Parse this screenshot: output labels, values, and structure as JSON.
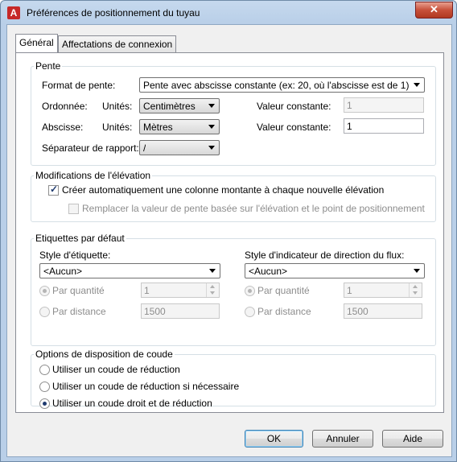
{
  "window": {
    "title": "Préférences de positionnement du tuyau",
    "app_icon": "A",
    "close_glyph": "✕"
  },
  "tabs": [
    {
      "label": "Général",
      "active": true
    },
    {
      "label": "Affectations de connexion",
      "active": false
    }
  ],
  "pente": {
    "legend": "Pente",
    "format_label": "Format de pente:",
    "format_value": "Pente avec abscisse constante (ex: 20, où l'abscisse est de 1)",
    "ordonnee_label": "Ordonnée:",
    "ordonnee_units_label": "Unités:",
    "ordonnee_units_value": "Centimètres",
    "ordonnee_const_label": "Valeur constante:",
    "ordonnee_const_value": "1",
    "abscisse_label": "Abscisse:",
    "abscisse_units_label": "Unités:",
    "abscisse_units_value": "Mètres",
    "abscisse_const_label": "Valeur constante:",
    "abscisse_const_value": "1",
    "separator_label": "Séparateur de rapport:",
    "separator_value": "/"
  },
  "elevation": {
    "legend": "Modifications de l'élévation",
    "create_riser_label": "Créer automatiquement une colonne montante à chaque nouvelle élévation",
    "create_riser_checked": true,
    "replace_slope_label": "Remplacer la valeur de pente basée sur l'élévation et le point de positionnement",
    "replace_slope_checked": false
  },
  "labels": {
    "legend": "Etiquettes par défaut",
    "tag_style_label": "Style d'étiquette:",
    "tag_style_value": "<Aucun>",
    "flow_style_label": "Style d'indicateur de direction du flux:",
    "flow_style_value": "<Aucun>",
    "by_quantity_label": "Par quantité",
    "by_distance_label": "Par distance",
    "tag_quantity_value": "1",
    "tag_distance_value": "1500",
    "flow_quantity_value": "1",
    "flow_distance_value": "1500"
  },
  "elbow": {
    "legend": "Options de disposition de coude",
    "options": [
      {
        "label": "Utiliser un coude de réduction",
        "selected": false
      },
      {
        "label": "Utiliser un coude de réduction si nécessaire",
        "selected": false
      },
      {
        "label": "Utiliser un coude droit et de réduction",
        "selected": true
      }
    ]
  },
  "buttons": {
    "ok": "OK",
    "cancel": "Annuler",
    "help": "Aide"
  }
}
